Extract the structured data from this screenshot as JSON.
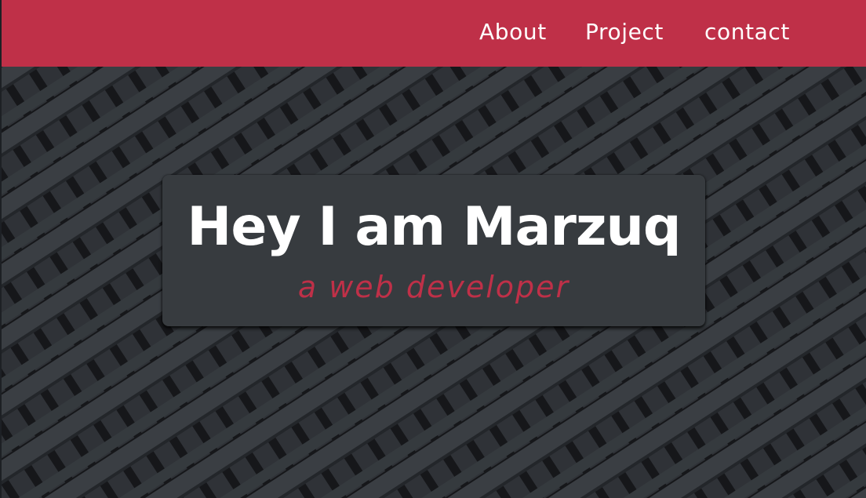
{
  "nav": {
    "links": [
      {
        "label": "About"
      },
      {
        "label": "Project"
      },
      {
        "label": "contact"
      }
    ]
  },
  "hero": {
    "title": "Hey I am Marzuq",
    "subtitle": "a web developer"
  },
  "colors": {
    "accent": "#bf3048",
    "background": "#353a3e",
    "card": "#373b3f",
    "text": "#ffffff"
  }
}
